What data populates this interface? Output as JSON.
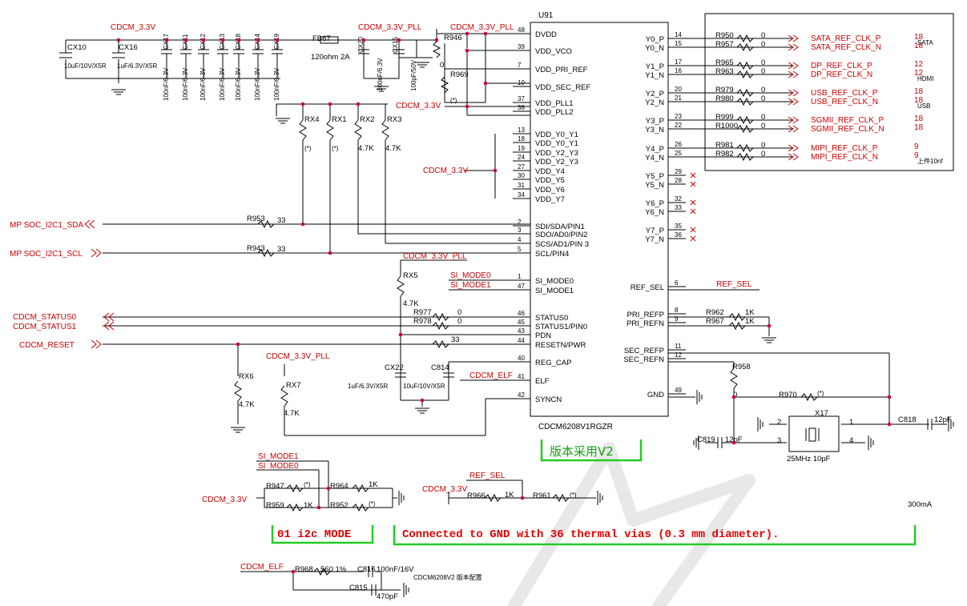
{
  "chip": {
    "refdes": "U91",
    "part": "CDCM6208V1RGZR",
    "left_pins": [
      {
        "num": "48",
        "name": "DVDD"
      },
      {
        "num": "39",
        "name": "VDD_VCO"
      },
      {
        "num": "7",
        "name": "VDD_PRI_REF"
      },
      {
        "num": "10",
        "name": "VDD_SEC_REF"
      },
      {
        "num": "37",
        "name": "VDD_PLL1"
      },
      {
        "num": "38",
        "name": "VDD_PLL2"
      },
      {
        "num": "13",
        "name": "VDD_Y0_Y1"
      },
      {
        "num": "18",
        "name": "VDD_Y0_Y1"
      },
      {
        "num": "19",
        "name": "VDD_Y2_Y3"
      },
      {
        "num": "24",
        "name": "VDD_Y2_Y3"
      },
      {
        "num": "27",
        "name": "VDD_Y4"
      },
      {
        "num": "30",
        "name": "VDD_Y5"
      },
      {
        "num": "31",
        "name": "VDD_Y6"
      },
      {
        "num": "34",
        "name": "VDD_Y7"
      },
      {
        "num": "2",
        "name": "SDI/SDA/PIN1"
      },
      {
        "num": "3",
        "name": "SDO/AD0/PIN2"
      },
      {
        "num": "4",
        "name": "SCS/AD1/PIN 3"
      },
      {
        "num": "5",
        "name": "SCL/PIN4"
      },
      {
        "num": "1",
        "name": "SI_MODE0"
      },
      {
        "num": "47",
        "name": "SI_MODE1"
      },
      {
        "num": "46",
        "name": "STATUS0"
      },
      {
        "num": "45",
        "name": "STATUS1/PIN0"
      },
      {
        "num": "43",
        "name": "PDN"
      },
      {
        "num": "44",
        "name": "RESETN/PWR"
      },
      {
        "num": "40",
        "name": "REG_CAP"
      },
      {
        "num": "41",
        "name": "ELF"
      },
      {
        "num": "42",
        "name": "SYNCN"
      }
    ],
    "right_pins": [
      {
        "num": "14",
        "name": "Y0_P"
      },
      {
        "num": "15",
        "name": "Y0_N"
      },
      {
        "num": "17",
        "name": "Y1_P"
      },
      {
        "num": "16",
        "name": "Y1_N"
      },
      {
        "num": "20",
        "name": "Y2_P"
      },
      {
        "num": "21",
        "name": "Y2_N"
      },
      {
        "num": "23",
        "name": "Y3_P"
      },
      {
        "num": "22",
        "name": "Y3_N"
      },
      {
        "num": "26",
        "name": "Y4_P"
      },
      {
        "num": "25",
        "name": "Y4_N"
      },
      {
        "num": "29",
        "name": "Y5_P"
      },
      {
        "num": "28",
        "name": "Y5_N"
      },
      {
        "num": "32",
        "name": "Y6_P"
      },
      {
        "num": "33",
        "name": "Y6_N"
      },
      {
        "num": "35",
        "name": "Y7_P"
      },
      {
        "num": "36",
        "name": "Y7_N"
      },
      {
        "num": "6",
        "name": "REF_SEL"
      },
      {
        "num": "8",
        "name": "PRI_REFP"
      },
      {
        "num": "9",
        "name": "PRI_REFN"
      },
      {
        "num": "11",
        "name": "SEC_REFP"
      },
      {
        "num": "12",
        "name": "SEC_REFN"
      },
      {
        "num": "49",
        "name": "GND"
      }
    ]
  },
  "outputs": [
    {
      "res": "R950",
      "val": "0",
      "net": "SATA_REF_CLK_P",
      "page": "18",
      "note": "SATA"
    },
    {
      "res": "R957",
      "val": "0",
      "net": "SATA_REF_CLK_N",
      "page": "18",
      "note": ""
    },
    {
      "res": "R965",
      "val": "0",
      "net": "DP_REF_CLK_P",
      "page": "12",
      "note": ""
    },
    {
      "res": "R963",
      "val": "0",
      "net": "DP_REF_CLK_N",
      "page": "12",
      "note": "HDMI"
    },
    {
      "res": "R979",
      "val": "0",
      "net": "USB_REF_CLK_P",
      "page": "18",
      "note": ""
    },
    {
      "res": "R980",
      "val": "0",
      "net": "USB_REF_CLK_N",
      "page": "18",
      "note": "USB"
    },
    {
      "res": "R999",
      "val": "0",
      "net": "SGMII_REF_CLK_P",
      "page": "18",
      "note": ""
    },
    {
      "res": "R1000",
      "val": "0",
      "net": "SGMII_REF_CLK_N",
      "page": "18",
      "note": ""
    },
    {
      "res": "R981",
      "val": "0",
      "net": "MIPI_REF_CLK_P",
      "page": "9",
      "note": ""
    },
    {
      "res": "R982",
      "val": "0",
      "net": "MIPI_REF_CLK_N",
      "page": "9",
      "note": "上件10nf"
    }
  ],
  "nets": {
    "cdcm33": "CDCM_3.3V",
    "cdcm33pll": "CDCM_3.3V_PLL",
    "sda": "MP SOC_I2C1_SDA",
    "scl": "MP SOC_I2C1_SCL",
    "status0": "CDCM_STATUS0",
    "status1": "CDCM_STATUS1",
    "reset": "CDCM_RESET",
    "elf": "CDCM_ELF",
    "ref_sel": "REF_SEL",
    "si_mode0": "SI_MODE0",
    "si_mode1": "SI_MODE1"
  },
  "parts": {
    "cx10": "CX10",
    "cx10_val": "10uF/10V/X5R",
    "cx16": "CX16",
    "cx16_val": "1uF/6.3V/X5R",
    "decaps": [
      {
        "ref": "CX17",
        "val": "100nF/6.3V"
      },
      {
        "ref": "CX11",
        "val": "100nF/6.3V"
      },
      {
        "ref": "CX12",
        "val": "100nF/6.3V"
      },
      {
        "ref": "CX13",
        "val": "100nF/6.3V"
      },
      {
        "ref": "CX18",
        "val": "100nF/6.3V"
      },
      {
        "ref": "CX14",
        "val": "100nF/6.3V"
      },
      {
        "ref": "CX19",
        "val": "100nF/6.3V"
      }
    ],
    "fb": "FB67",
    "fb_val": "120ohm 2A",
    "cx20": "CX20",
    "cx20_val": "100nF/6.3V",
    "cx15": "CX15",
    "cx15_val": "100pF/50V",
    "r946": "R946",
    "r946_val": "0",
    "r969": "R969",
    "r969_val": "(*)",
    "rx4": "RX4",
    "rx4_val": "(*)",
    "rx1": "RX1",
    "rx1_val": "(*)",
    "rx2": "RX2",
    "rx2_val": "4.7K",
    "rx3": "RX3",
    "rx3_val": "4.7K",
    "r953": "R953",
    "r953_val": "33",
    "r943": "R943",
    "r943_val": "33",
    "rx5": "RX5",
    "rx5_val": "4.7K",
    "r977": "R977",
    "r977_val": "0",
    "r978": "R978",
    "r978_val": "0",
    "r_reset_val": "33",
    "rx6": "RX6",
    "rx6_val": "4.7K",
    "rx7": "RX7",
    "rx7_val": "4.7K",
    "cx22": "CX22",
    "cx22_val": "1uF/6.3V/X5R",
    "c814": "C814",
    "c814_val": "10uF/10V/X5R",
    "r962": "R962",
    "r962_val": "1K",
    "r967": "R967",
    "r967_val": "1K",
    "r958": "R958",
    "r958_val": "0",
    "r970": "R970",
    "r970_val": "(*)",
    "x17": "X17",
    "x17_val": "25MHz 10pF",
    "c818": "C818",
    "c818_val": "12pF",
    "c819": "C819",
    "c819_val": "12pF",
    "r947": "R947",
    "r947_val": "(*)",
    "r964": "R964",
    "r964_val": "1K",
    "r959": "R959",
    "r959_val": "1K",
    "r952": "R952",
    "r952_val": "(*)",
    "r966": "R966",
    "r966_val": "1K",
    "r961": "R961",
    "r961_val": "(*)",
    "r968": "R968",
    "r968_val": "560 1%",
    "c816": "C816",
    "c816_val": "100nF/16V",
    "c815": "C815",
    "c815_val": "470pF"
  },
  "notes": {
    "version_v2": "版本采用V2",
    "i2c_mode": "01 i2c MODE",
    "thermal": "Connected to GND with 36 thermal vias (0.3 mm diameter).",
    "current": "300mA",
    "config": "CDCM6208V2 版本配置"
  },
  "colors": {
    "wire": "#000000",
    "net": "#cc0000",
    "highlight": "#22cc22",
    "annotation": "#e00000",
    "junction": "#cc0044"
  }
}
